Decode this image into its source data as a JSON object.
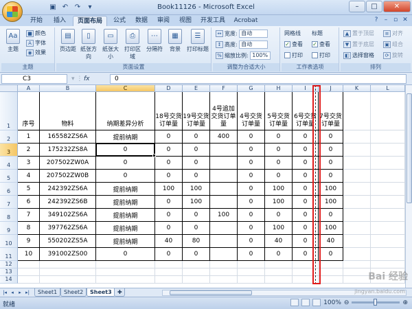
{
  "window": {
    "title": "Book11126 - Microsoft Excel"
  },
  "qat": [
    "save-icon",
    "undo-icon",
    "redo-icon"
  ],
  "tabs": [
    "开始",
    "插入",
    "页面布局",
    "公式",
    "数据",
    "审阅",
    "视图",
    "开发工具",
    "Acrobat"
  ],
  "active_tab": "页面布局",
  "ribbon": {
    "theme": {
      "big": "主题",
      "small": [
        "颜色",
        "字体",
        "效果"
      ],
      "label": "主题"
    },
    "page_setup": {
      "buttons": [
        "页边距",
        "纸张方向",
        "纸张大小",
        "打印区域",
        "分隔符",
        "背景",
        "打印标题"
      ],
      "label": "页面设置"
    },
    "scale_to_fit": {
      "width_label": "宽度:",
      "width_value": "自动",
      "height_label": "高度:",
      "height_value": "自动",
      "scale_label": "缩放比例:",
      "scale_value": "100%",
      "label": "调整为合适大小"
    },
    "sheet_options": {
      "gridlines": "网格线",
      "headings": "标题",
      "view": "查看",
      "print": "打印",
      "label": "工作表选项"
    },
    "arrange": {
      "items": [
        "置于顶层",
        "对齐",
        "置于底层",
        "组合",
        "选择窗格",
        "旋转"
      ],
      "label": "排列"
    }
  },
  "formula_bar": {
    "name_box": "C3",
    "fx": "fx",
    "value": "0"
  },
  "columns": [
    "A",
    "B",
    "C",
    "D",
    "E",
    "F",
    "G",
    "H",
    "I",
    "J",
    "K",
    "L"
  ],
  "rows": [
    "1",
    "2",
    "3",
    "4",
    "5",
    "6",
    "7",
    "8",
    "9",
    "10",
    "11",
    "12",
    "13",
    "14"
  ],
  "header_row": [
    "序号",
    "物料",
    "纳期差异分析",
    "18号交货订单量",
    "19号交货订单量",
    "4号追加交货订单量",
    "4号交货订单量",
    "5号交货订单量",
    "6号交货订单量",
    "7号交货订单量"
  ],
  "table_rows": [
    [
      "1",
      "165582ZS6A",
      "提前纳期",
      "0",
      "0",
      "400",
      "0",
      "0",
      "0",
      "0"
    ],
    [
      "2",
      "175232ZS8A",
      "0",
      "0",
      "0",
      "",
      "0",
      "0",
      "0",
      "0"
    ],
    [
      "3",
      "207502ZW0A",
      "0",
      "0",
      "0",
      "",
      "0",
      "0",
      "0",
      "0"
    ],
    [
      "4",
      "207502ZW0B",
      "0",
      "0",
      "0",
      "",
      "0",
      "0",
      "0",
      "0"
    ],
    [
      "5",
      "242392ZS6A",
      "提前纳期",
      "100",
      "100",
      "",
      "0",
      "100",
      "0",
      "100"
    ],
    [
      "6",
      "242392ZS6B",
      "提前纳期",
      "0",
      "100",
      "",
      "0",
      "100",
      "0",
      "100"
    ],
    [
      "7",
      "349102ZS6A",
      "提前纳期",
      "0",
      "0",
      "100",
      "0",
      "0",
      "0",
      "0"
    ],
    [
      "8",
      "397762ZS6A",
      "提前纳期",
      "0",
      "0",
      "",
      "0",
      "100",
      "0",
      "100"
    ],
    [
      "9",
      "550202ZS5A",
      "提前纳期",
      "40",
      "80",
      "",
      "0",
      "40",
      "0",
      "40"
    ],
    [
      "10",
      "391002ZS00",
      "0",
      "0",
      "0",
      "",
      "0",
      "0",
      "0",
      "0"
    ]
  ],
  "sheets": [
    "Sheet1",
    "Sheet2",
    "Sheet3"
  ],
  "active_sheet": "Sheet3",
  "status": {
    "ready": "就绪",
    "zoom": "100%"
  },
  "watermark": {
    "brand": "Bai 经验",
    "url": "jingyan.baidu.com"
  },
  "colors": {
    "highlight_box": "#e11b1b",
    "selected_header": "#f5c665"
  }
}
